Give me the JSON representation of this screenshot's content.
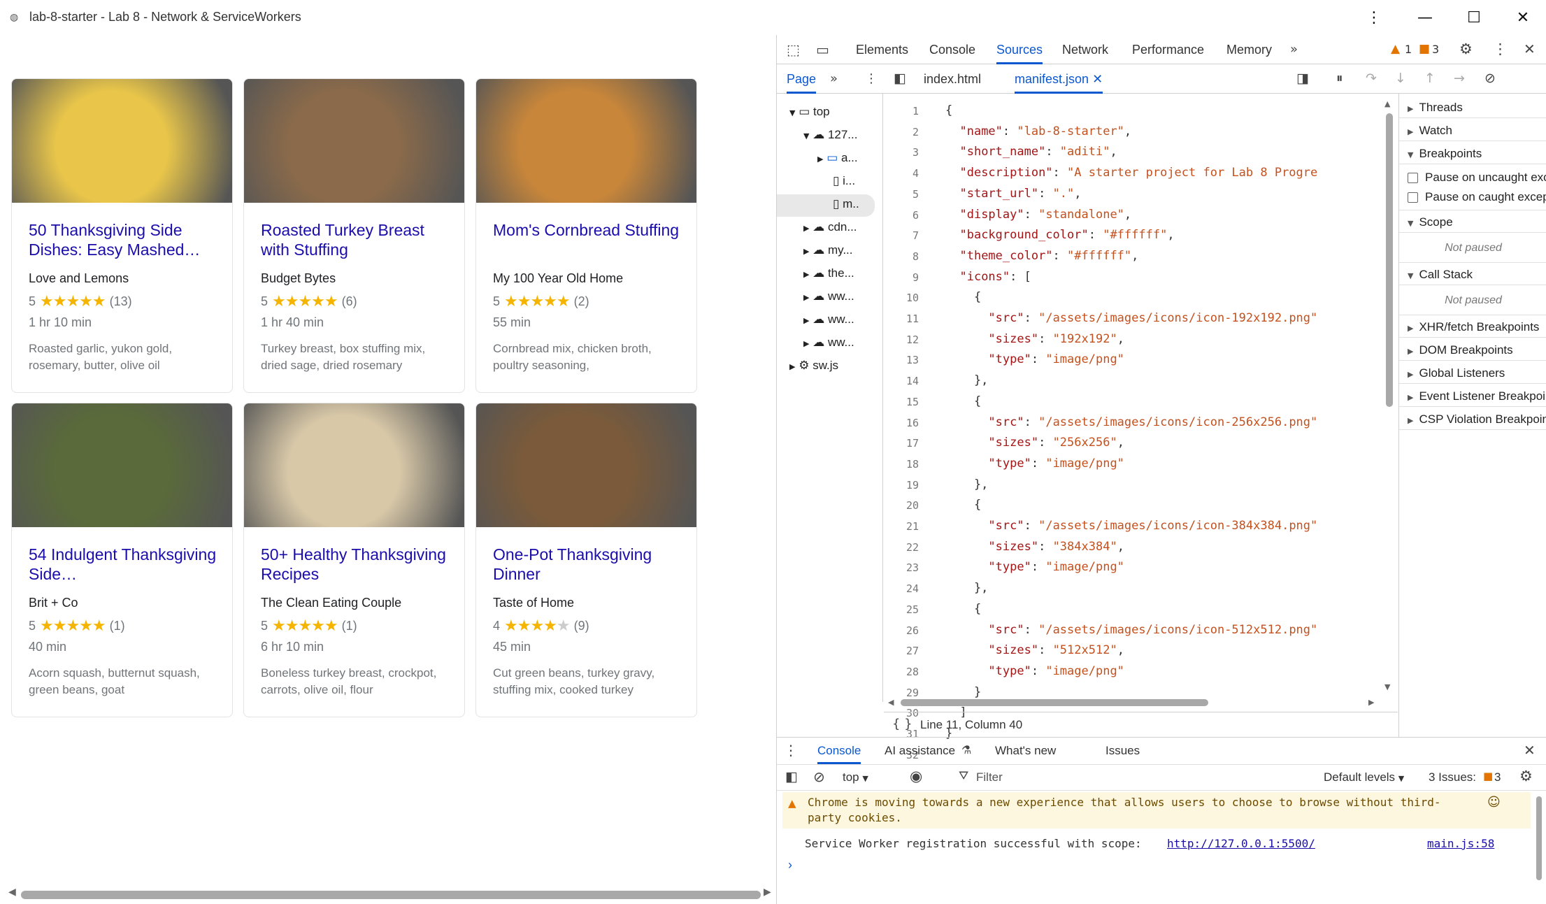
{
  "window": {
    "title": "lab-8-starter - Lab 8 - Network & ServiceWorkers"
  },
  "recipes": [
    {
      "title": "50 Thanksgiving Side Dishes: Easy Mashed…",
      "source": "Love and Lemons",
      "rating": "5",
      "stars": 5,
      "reviews": "(13)",
      "time": "1 hr 10 min",
      "ingredients": "Roasted garlic, yukon gold, rosemary, butter, olive oil",
      "img_color": "#e9c64a"
    },
    {
      "title": "Roasted Turkey Breast with Stuffing",
      "source": "Budget Bytes",
      "rating": "5",
      "stars": 5,
      "reviews": "(6)",
      "time": "1 hr 40 min",
      "ingredients": "Turkey breast, box stuffing mix, dried sage, dried rosemary",
      "img_color": "#8a6a4a"
    },
    {
      "title": "Mom's Cornbread Stuffing",
      "source": "My 100 Year Old Home",
      "rating": "5",
      "stars": 5,
      "reviews": "(2)",
      "time": "55 min",
      "ingredients": "Cornbread mix, chicken broth, poultry seasoning,",
      "img_color": "#c8863a"
    },
    {
      "title": "54 Indulgent Thanksgiving Side…",
      "source": "Brit + Co",
      "rating": "5",
      "stars": 5,
      "reviews": "(1)",
      "time": "40 min",
      "ingredients": "Acorn squash, butternut squash, green beans, goat",
      "img_color": "#5a6a3a"
    },
    {
      "title": "50+ Healthy Thanksgiving Recipes",
      "source": "The Clean Eating Couple",
      "rating": "5",
      "stars": 5,
      "reviews": "(1)",
      "time": "6 hr 10 min",
      "ingredients": "Boneless turkey breast, crockpot, carrots, olive oil, flour",
      "img_color": "#d8c8a8"
    },
    {
      "title": "One-Pot Thanksgiving Dinner",
      "source": "Taste of Home",
      "rating": "4",
      "stars": 4,
      "reviews": "(9)",
      "time": "45 min",
      "ingredients": "Cut green beans, turkey gravy, stuffing mix, cooked turkey",
      "img_color": "#7a5a3a"
    }
  ],
  "devtools": {
    "tabs": [
      "Elements",
      "Console",
      "Sources",
      "Network",
      "Performance",
      "Memory"
    ],
    "active_tab": "Sources",
    "warnings_count": "1",
    "issues_count": "3",
    "nav_tab": "Page",
    "file_tabs": [
      "index.html",
      "manifest.json"
    ],
    "tree": [
      "top",
      "127...",
      "a...",
      "i...",
      "m..",
      "cdn...",
      "my...",
      "the...",
      "ww...",
      "ww...",
      "ww...",
      "sw.js"
    ],
    "code_lines": [
      "{",
      "  \"name\": \"lab-8-starter\",",
      "  \"short_name\": \"aditi\",",
      "  \"description\": \"A starter project for Lab 8 Progre",
      "  \"start_url\": \".\",",
      "  \"display\": \"standalone\",",
      "  \"background_color\": \"#ffffff\",",
      "  \"theme_color\": \"#ffffff\",",
      "  \"icons\": [",
      "    {",
      "      \"src\": \"/assets/images/icons/icon-192x192.png\"",
      "      \"sizes\": \"192x192\",",
      "      \"type\": \"image/png\"",
      "    },",
      "    {",
      "      \"src\": \"/assets/images/icons/icon-256x256.png\"",
      "      \"sizes\": \"256x256\",",
      "      \"type\": \"image/png\"",
      "    },",
      "    {",
      "      \"src\": \"/assets/images/icons/icon-384x384.png\"",
      "      \"sizes\": \"384x384\",",
      "      \"type\": \"image/png\"",
      "    },",
      "    {",
      "      \"src\": \"/assets/images/icons/icon-512x512.png\"",
      "      \"sizes\": \"512x512\",",
      "      \"type\": \"image/png\"",
      "    }",
      "  ]",
      "}",
      ""
    ],
    "cursor_status": "Line 11, Column 40",
    "debugger": {
      "sections_top": [
        "Threads",
        "Watch",
        "Breakpoints"
      ],
      "pause_uncaught": "Pause on uncaught exceptions",
      "pause_caught": "Pause on caught exceptions",
      "scope": "Scope",
      "not_paused": "Not paused",
      "call_stack": "Call Stack",
      "sections_bottom": [
        "XHR/fetch Breakpoints",
        "DOM Breakpoints",
        "Global Listeners",
        "Event Listener Breakpoints",
        "CSP Violation Breakpoints"
      ]
    },
    "drawer": {
      "tabs": [
        "Console",
        "AI assistance",
        "What's new",
        "Issues"
      ],
      "context": "top",
      "filter_placeholder": "Filter",
      "levels": "Default levels",
      "issues_label": "3 Issues:",
      "issues_count": "3",
      "warning_line1": "Chrome is moving towards a new experience that allows users to choose to browse without third-",
      "warning_line2": "party cookies.",
      "log_message": "Service Worker registration successful with scope:",
      "log_link": "http://127.0.0.1:5500/",
      "log_source": "main.js:58",
      "prompt": "›"
    }
  }
}
